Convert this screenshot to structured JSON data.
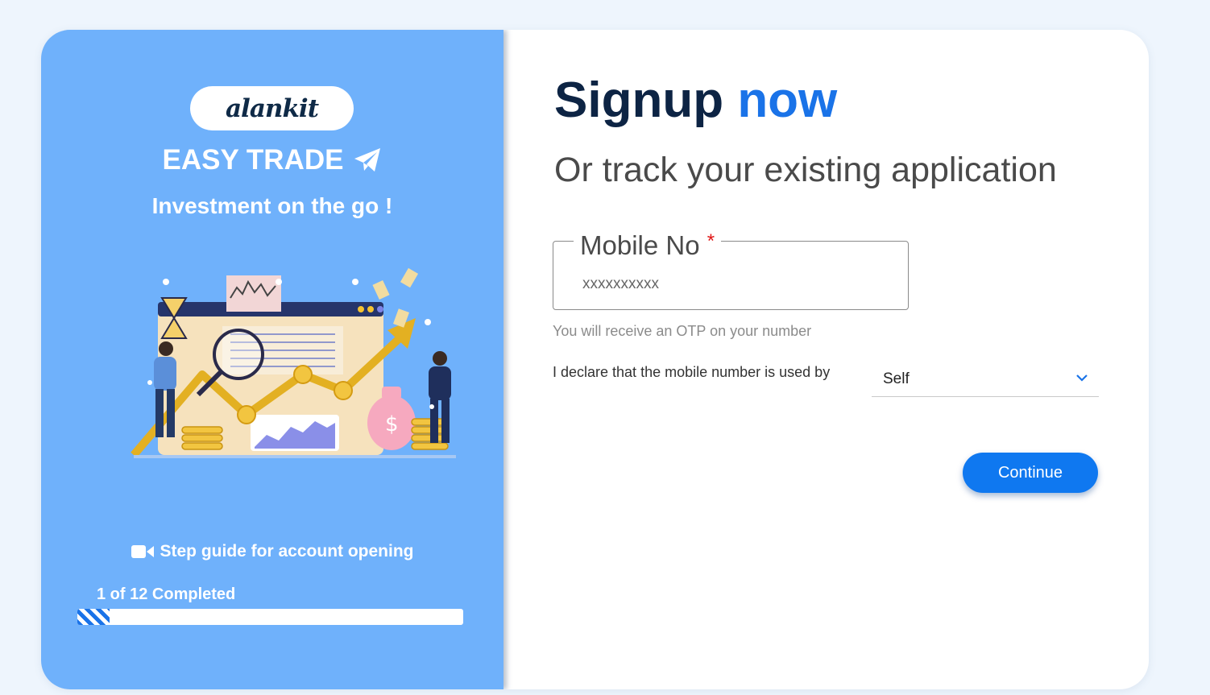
{
  "brand": {
    "logo_text": "alankit",
    "product_name": "EASY TRADE",
    "tagline": "Investment on the go !"
  },
  "illustration": {
    "icon": "trading-growth-illustration"
  },
  "guide": {
    "label": "Step guide for account opening",
    "icon": "video-camera-icon",
    "progress_text": "1 of 12 Completed",
    "progress_completed": 1,
    "progress_total": 12
  },
  "form": {
    "title_main": "Signup",
    "title_accent": "now",
    "subtitle": "Or track your existing application",
    "mobile_label": "Mobile No",
    "required_mark": "*",
    "mobile_placeholder": "xxxxxxxxxx",
    "otp_hint": "You will receive an OTP on your number",
    "declare_label": "I declare that the mobile number is used by",
    "declare_selected": "Self",
    "continue_label": "Continue"
  },
  "colors": {
    "left_panel": "#6fb1fb",
    "accent": "#1a73e8",
    "title": "#0d2444",
    "button": "#0f78f0",
    "page_bg": "#eef5fd"
  }
}
